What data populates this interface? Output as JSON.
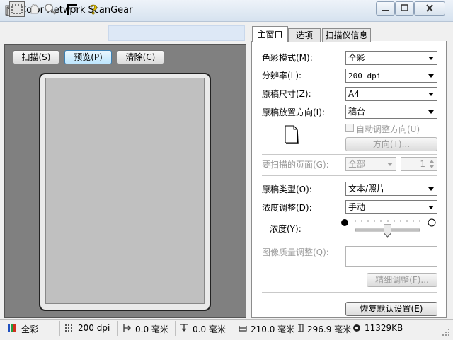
{
  "window": {
    "title": "Color Network ScanGear"
  },
  "toolbar": {
    "scan_label": "扫描(S)",
    "preview_label": "预览(P)",
    "clear_label": "清除(C)"
  },
  "tabs": [
    {
      "label": "主窗口",
      "active": true
    },
    {
      "label": "选项",
      "active": false
    },
    {
      "label": "扫描仪信息",
      "active": false
    }
  ],
  "settings": {
    "color_mode": {
      "label": "色彩模式(M):",
      "value": "全彩"
    },
    "resolution": {
      "label": "分辨率(L):",
      "value": "200 dpi"
    },
    "original_size": {
      "label": "原稿尺寸(Z):",
      "value": "A4"
    },
    "orientation": {
      "label": "原稿放置方向(I):",
      "value": "稿台"
    },
    "auto_orient_label": "自动调整方向(U)",
    "direction_button": "方向(T)...",
    "pages": {
      "label": "要扫描的页面(G):",
      "value": "全部",
      "stepper": "1"
    },
    "original_type": {
      "label": "原稿类型(O):",
      "value": "文本/照片"
    },
    "density_adjust": {
      "label": "浓度调整(D):",
      "value": "手动"
    },
    "density_label": "浓度(Y):",
    "density_level": 0.5,
    "image_quality_label": "图像质量调整(Q):",
    "fine_adjust_button": "精细调整(F)...",
    "restore_defaults_button": "恢复默认设置(E)"
  },
  "status_bar": {
    "color_mode": "全彩",
    "resolution": "200 dpi",
    "left_offset": "0.0 毫米",
    "top_offset": "0.0 毫米",
    "width": "210.0 毫米",
    "height": "296.9 毫米",
    "file_size": "11329KB"
  }
}
